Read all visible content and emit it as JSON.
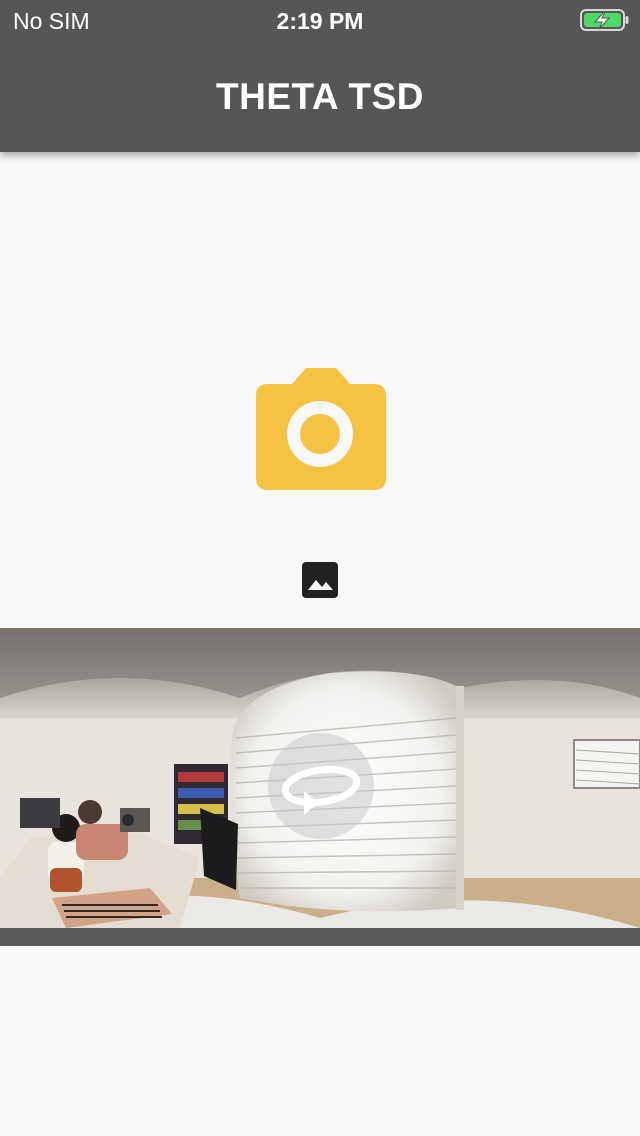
{
  "status_bar": {
    "carrier": "No SIM",
    "time": "2:19 PM",
    "battery_icon": "battery-charging-icon"
  },
  "header": {
    "title": "THETA TSD",
    "background_color": "#565656"
  },
  "main": {
    "capture_button_icon": "camera-icon",
    "capture_color": "#f5c242",
    "gallery_button_icon": "image-icon",
    "panorama_icon": "rotate-360-icon"
  }
}
